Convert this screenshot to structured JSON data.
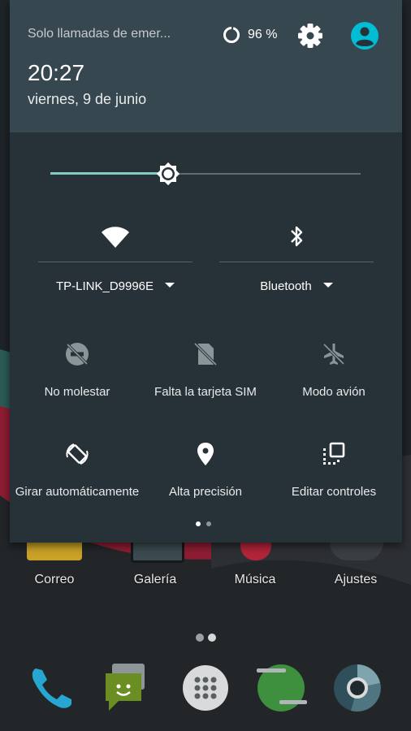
{
  "shade": {
    "carrier_text": "Solo llamadas de emer...",
    "battery_percent_label": "96 %",
    "battery_level": 0.96,
    "time": "20:27",
    "date": "viernes, 9 de junio",
    "brightness_level": 0.38
  },
  "tiles_large": [
    {
      "label": "TP-LINK_D9996E",
      "icon": "wifi-icon"
    },
    {
      "label": "Bluetooth",
      "icon": "bluetooth-icon"
    }
  ],
  "tiles": [
    {
      "label": "No molestar",
      "icon": "do-not-disturb-icon"
    },
    {
      "label": "Falta la tarjeta SIM",
      "icon": "no-sim-icon"
    },
    {
      "label": "Modo avión",
      "icon": "airplane-off-icon"
    },
    {
      "label": "Girar automáticamente",
      "icon": "rotate-icon"
    },
    {
      "label": "Alta precisión",
      "icon": "location-icon"
    },
    {
      "label": "Editar controles",
      "icon": "edit-tiles-icon"
    }
  ],
  "home": {
    "apps": [
      "Correo",
      "Galería",
      "Música",
      "Ajustes"
    ],
    "dock": [
      "phone-icon",
      "messaging-icon",
      "app-drawer-icon",
      "hangouts-icon",
      "chrome-icon"
    ]
  },
  "colors": {
    "shade_bg": "#263238",
    "shade_header_bg": "#37474f",
    "accent": "#80cbc4",
    "user_icon": "#00bcd4"
  }
}
